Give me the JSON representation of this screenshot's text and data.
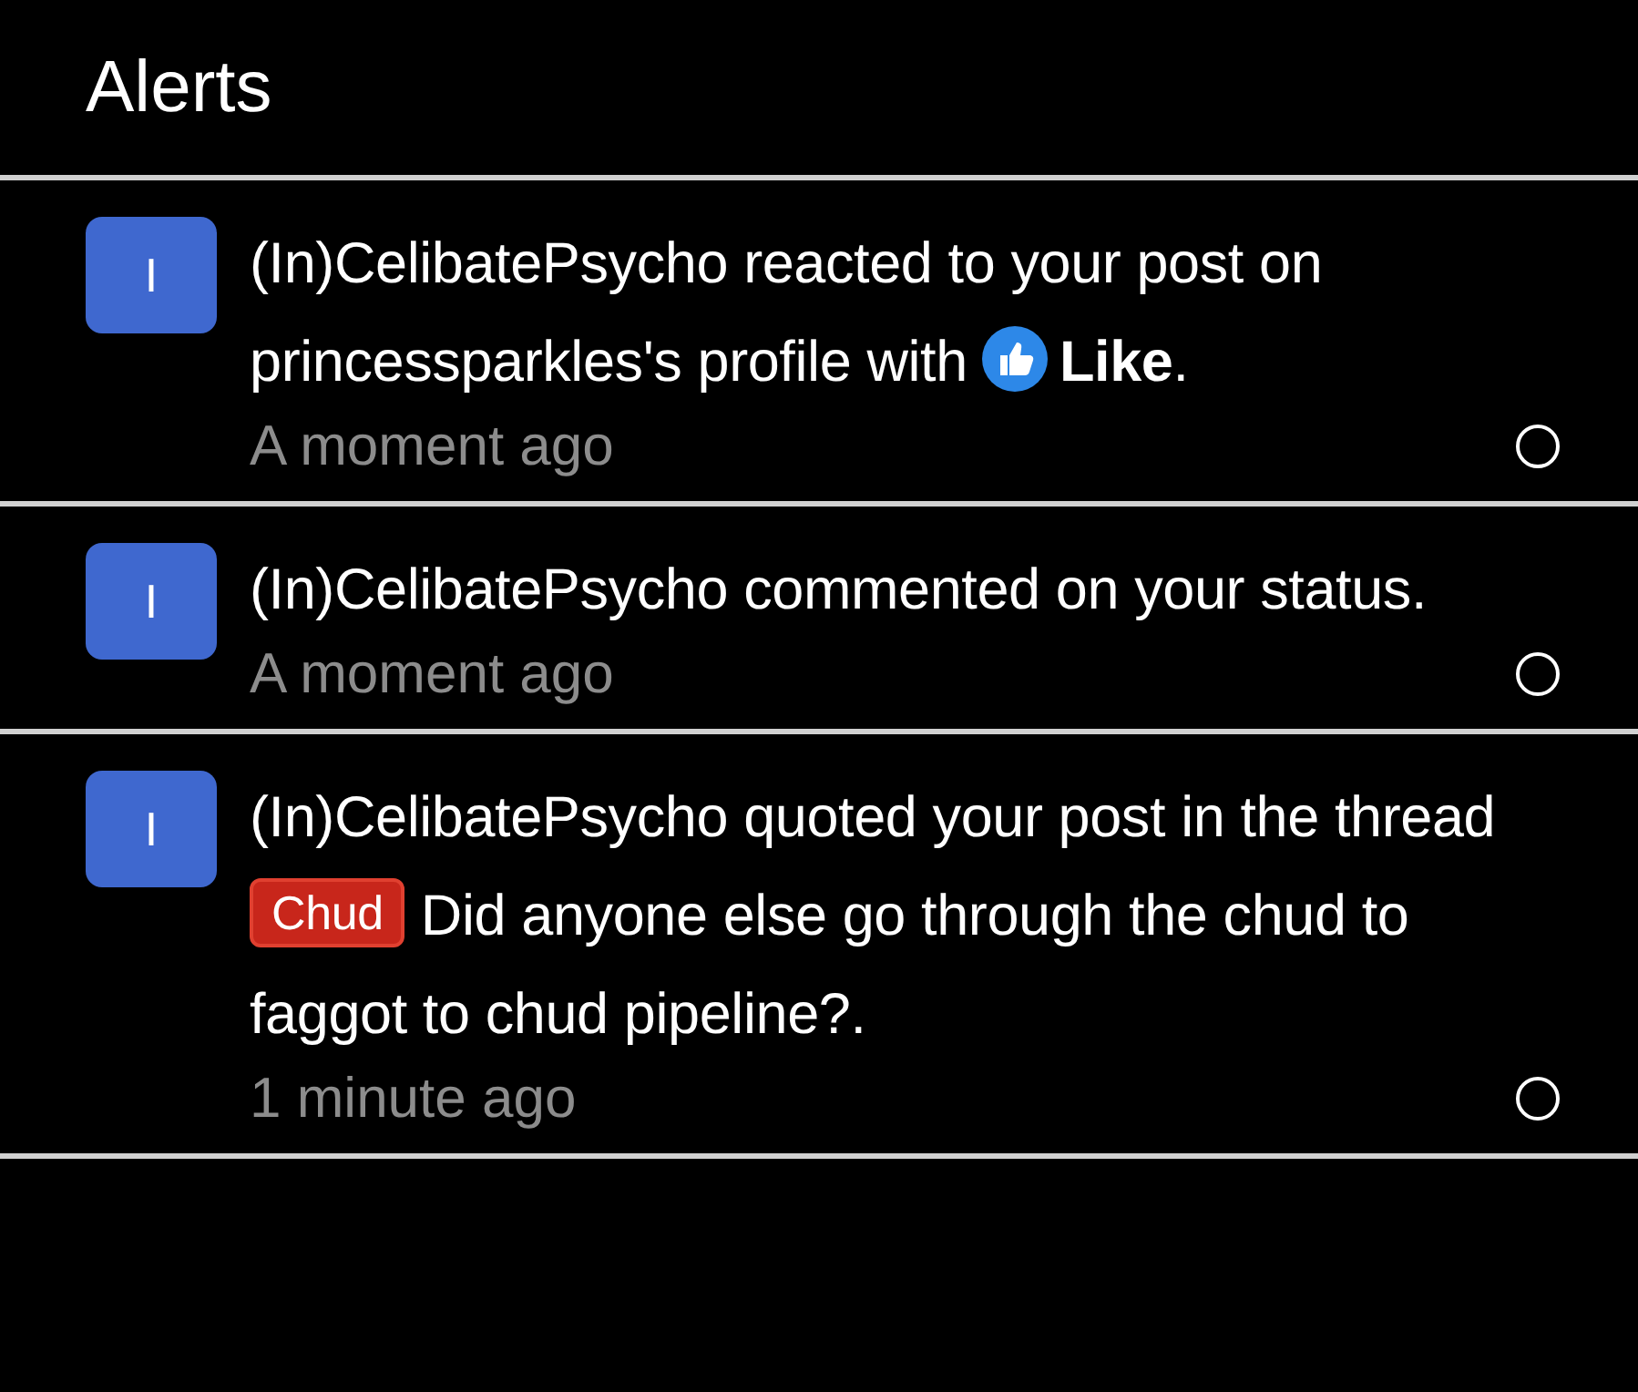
{
  "header": {
    "title": "Alerts"
  },
  "alerts": [
    {
      "avatar": "I",
      "parts": [
        {
          "kind": "text",
          "text": "(In)CelibatePsycho reacted to your post on princessparkles's profile with "
        },
        {
          "kind": "reaction",
          "text": "Like"
        },
        {
          "kind": "text",
          "text": "."
        }
      ],
      "time": "A moment ago"
    },
    {
      "avatar": "I",
      "parts": [
        {
          "kind": "text",
          "text": "(In)CelibatePsycho commented on your status."
        }
      ],
      "time": "A moment ago"
    },
    {
      "avatar": "I",
      "parts": [
        {
          "kind": "text",
          "text": "(In)CelibatePsycho quoted your post in the thread "
        },
        {
          "kind": "prefix",
          "text": "Chud"
        },
        {
          "kind": "text",
          "text": " Did anyone else go through the chud to faggot to chud pipeline?."
        }
      ],
      "time": "1 minute ago"
    }
  ]
}
